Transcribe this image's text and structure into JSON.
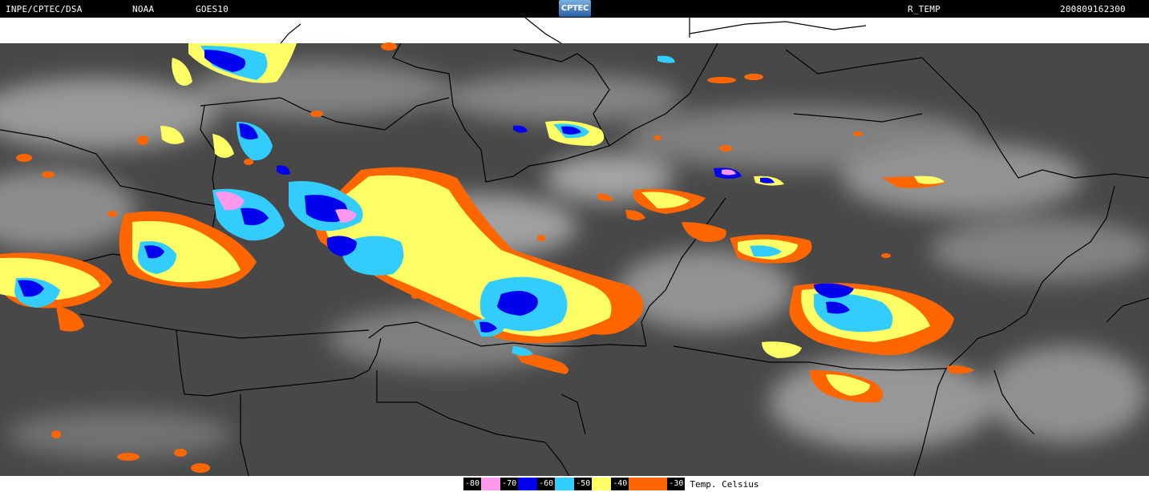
{
  "header": {
    "source": "INPE/CPTEC/DSA",
    "agency": "NOAA",
    "satellite": "GOES10",
    "logo_text": "CPTEC",
    "product": "R_TEMP",
    "timestamp": "200809162300"
  },
  "map": {
    "icon": "satellite-infrared-map",
    "palette": {
      "background_cloud": "#4a4a4a",
      "bright_cloud": "#bdbdbd",
      "border_line": "#000000",
      "outside_area": "#ffffff"
    }
  },
  "legend": {
    "title": "Temp. Celsius",
    "levels": [
      {
        "label": "-80",
        "color": "#ff99ee"
      },
      {
        "label": "-70",
        "color": "#0000ee"
      },
      {
        "label": "-60",
        "color": "#33ccff"
      },
      {
        "label": "-50",
        "color": "#ffff66"
      },
      {
        "label": "-40",
        "color": "#ff6600"
      },
      {
        "label": "-30",
        "color": "#ffffff"
      }
    ]
  }
}
